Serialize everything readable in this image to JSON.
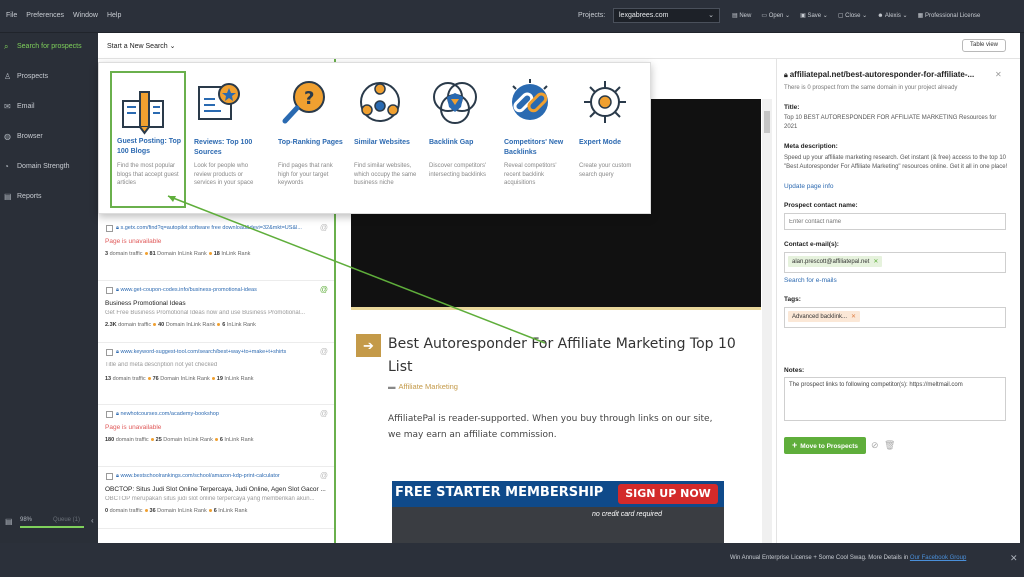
{
  "menu": [
    "File",
    "Preferences",
    "Window",
    "Help"
  ],
  "projects": {
    "label": "Projects:",
    "selected": "lexgabrees.com"
  },
  "toolbar": [
    "New",
    "Open",
    "Save",
    "Close",
    "Alexis",
    "Professional License"
  ],
  "sidebar": {
    "items": [
      "Search for prospects",
      "Prospects",
      "Email",
      "Browser",
      "Domain Strength",
      "Reports"
    ],
    "progress_label": "98%",
    "progress_value": 0.98,
    "status": "Queue (1)"
  },
  "main": {
    "start_search": "Start a New Search",
    "table_view": "Table view"
  },
  "search_options": [
    {
      "title": "Guest Posting: Top 100 Blogs",
      "desc": "Find the most popular blogs that accept guest articles"
    },
    {
      "title": "Reviews: Top 100 Sources",
      "desc": "Look for people who review products or services in your space"
    },
    {
      "title": "Top-Ranking Pages",
      "desc": "Find pages that rank high for your target keywords"
    },
    {
      "title": "Similar Websites",
      "desc": "Find similar websites, which occupy the same business niche"
    },
    {
      "title": "Backlink Gap",
      "desc": "Discover competitors' intersecting backlinks"
    },
    {
      "title": "Competitors' New Backlinks",
      "desc": "Reveal competitors' recent backlink acquisitions"
    },
    {
      "title": "Expert Mode",
      "desc": "Create your custom search query"
    }
  ],
  "rows": [
    {
      "url": "s.getx.com/find?q=autopilot software free download&devi=32&mkt=US&l...",
      "title": "",
      "desc": "",
      "unavailable": "Page is unavailable",
      "traffic": "3",
      "traffic_label": "domain traffic",
      "rank": "81",
      "rank_label": "Domain InLink Rank",
      "inlink": "18",
      "inlink_label": "InLink Rank",
      "at_green": false
    },
    {
      "url": "www.get-coupon-codes.info/business-promotional-ideas",
      "title": "Business Promotional Ideas",
      "desc": "Get Free Business Promotional Ideas now and use Business Promotional...",
      "unavailable": "",
      "traffic": "2.3K",
      "traffic_label": "domain traffic",
      "rank": "40",
      "rank_label": "Domain InLink Rank",
      "inlink": "6",
      "inlink_label": "InLink Rank",
      "at_green": true
    },
    {
      "url": "www.keyword-suggest-tool.com/search/best+way+to+make+t+shirts",
      "title": "",
      "desc": "Title and meta description not yet checked",
      "unavailable": "",
      "traffic": "13",
      "traffic_label": "domain traffic",
      "rank": "76",
      "rank_label": "Domain InLink Rank",
      "inlink": "19",
      "inlink_label": "InLink Rank",
      "at_green": false
    },
    {
      "url": "newhotcourses.com/academy-bookshop",
      "title": "",
      "desc": "",
      "unavailable": "Page is unavailable",
      "traffic": "180",
      "traffic_label": "domain traffic",
      "rank": "25",
      "rank_label": "Domain InLink Rank",
      "inlink": "6",
      "inlink_label": "InLink Rank",
      "at_green": false
    },
    {
      "url": "www.bestschoolrankings.com/school/amazon-kdp-print-calculator",
      "title": "OBCTOP: Situs Judi Slot Online Terpercaya, Judi Online, Agen Slot Gacor ...",
      "desc": "OBCTOP merupakan situs judi slot online terpercaya yang memberikan akun...",
      "unavailable": "",
      "traffic": "0",
      "traffic_label": "domain traffic",
      "rank": "36",
      "rank_label": "Domain InLink Rank",
      "inlink": "6",
      "inlink_label": "InLink Rank",
      "at_green": false
    }
  ],
  "preview": {
    "title": "Best Autoresponder For Affiliate Marketing Top 10 List",
    "category": "Affiliate Marketing",
    "text": "AffiliatePal is reader-supported. When you buy through links on our site, we may earn an affiliate commission.",
    "banner": "FREE STARTER MEMBERSHIP",
    "banner_btn": "SIGN UP NOW",
    "banner_note": "no credit card required"
  },
  "detail": {
    "url": "affiliatepal.net/best-autoresponder-for-affiliate-...",
    "note": "There is 0 prospect from the same domain in your project already",
    "title_label": "Title:",
    "title": "Top 10 BEST AUTORESPONDER FOR AFFILIATE MARKETING Resources for 2021",
    "meta_label": "Meta description:",
    "meta": "Speed up your affiliate marketing research. Get instant (& free) access to the top 10 \"Best Autoresponder For Affiliate Marketing\" resources online. Get it all in one place!",
    "update_link": "Update page info",
    "contact_label": "Prospect contact name:",
    "contact_placeholder": "Enter contact name",
    "email_label": "Contact e-mail(s):",
    "email": "alan.prescott@affiliatepal.net",
    "search_emails": "Search for e-mails",
    "tags_label": "Tags:",
    "tag": "Advanced backlink...",
    "notes_label": "Notes:",
    "notes": "The prospect links to following competitor(s): https://meltmail.com",
    "move_btn": "Move to Prospects"
  },
  "footer": {
    "text": "Win Annual Enterprise License + Some Cool Swag. More Details in ",
    "link": "Our Facebook Group"
  },
  "colors": {
    "accent_green": "#5fae3b",
    "link_blue": "#2d6ab1",
    "error_red": "#e05a5a"
  }
}
